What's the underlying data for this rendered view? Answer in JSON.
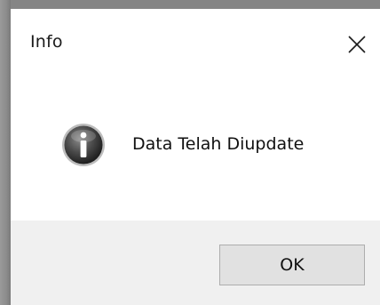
{
  "window": {
    "title": "Info"
  },
  "dialog": {
    "icon": "information-icon",
    "message": "Data Telah Diupdate"
  },
  "buttons": {
    "ok_label": "OK",
    "close_icon": "close-icon"
  },
  "colors": {
    "footer_bg": "#f0f0f0",
    "button_bg": "#e1e1e1",
    "button_border": "#adadad",
    "icon_fill": "#3a3a3a"
  }
}
